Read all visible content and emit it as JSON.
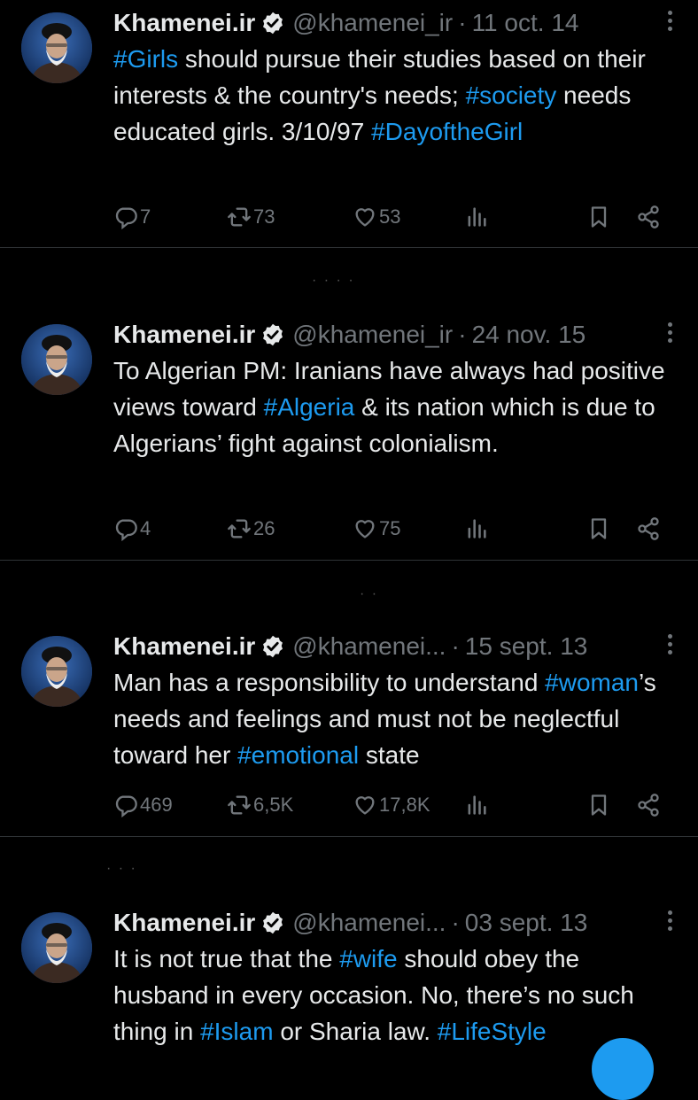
{
  "colors": {
    "background": "#000000",
    "text": "#e7e9ea",
    "muted": "#71767b",
    "accent": "#1d9bf0",
    "divider": "#2f3336"
  },
  "icons": {
    "verified": "verified-badge-icon",
    "more": "more-options-icon",
    "reply": "reply-icon",
    "retweet": "retweet-icon",
    "like": "like-icon",
    "views": "views-icon",
    "bookmark": "bookmark-icon",
    "share": "share-icon"
  },
  "tweets": [
    {
      "name": "Khamenei.ir",
      "handle": "@khamenei_ir",
      "date": "11 oct. 14",
      "segments": [
        {
          "t": "#Girls",
          "h": true
        },
        {
          "t": " should pursue their studies based on their interests & the country's needs; ",
          "h": false
        },
        {
          "t": "#society",
          "h": true
        },
        {
          "t": " needs educated girls. 3/10/97 ",
          "h": false
        },
        {
          "t": "#DayoftheGirl",
          "h": true
        }
      ],
      "replies": "7",
      "retweets": "73",
      "likes": "53"
    },
    {
      "name": "Khamenei.ir",
      "handle": "@khamenei_ir",
      "date": "24 nov. 15",
      "segments": [
        {
          "t": "To Algerian PM: Iranians have always had positive views toward ",
          "h": false
        },
        {
          "t": "#Algeria",
          "h": true
        },
        {
          "t": " & its nation which is due to Algerians’ fight against colonialism.",
          "h": false
        }
      ],
      "replies": "4",
      "retweets": "26",
      "likes": "75"
    },
    {
      "name": "Khamenei.ir",
      "handle": "@khamenei...",
      "date": "15 sept. 13",
      "segments": [
        {
          "t": "Man has a responsibility to understand ",
          "h": false
        },
        {
          "t": "#woman",
          "h": true
        },
        {
          "t": "’s needs and feelings and must not be neglectful toward her ",
          "h": false
        },
        {
          "t": "#emotional",
          "h": true
        },
        {
          "t": " state",
          "h": false
        }
      ],
      "replies": "469",
      "retweets": "6,5K",
      "likes": "17,8K"
    },
    {
      "name": "Khamenei.ir",
      "handle": "@khamenei...",
      "date": "03 sept. 13",
      "segments": [
        {
          "t": "It is not true that the ",
          "h": false
        },
        {
          "t": "#wife",
          "h": true
        },
        {
          "t": " should obey the husband in every occasion. No, there’s no such thing in ",
          "h": false
        },
        {
          "t": "#Islam",
          "h": true
        },
        {
          "t": " or Sharia law. ",
          "h": false
        },
        {
          "t": "#LifeStyle",
          "h": true
        }
      ]
    }
  ]
}
